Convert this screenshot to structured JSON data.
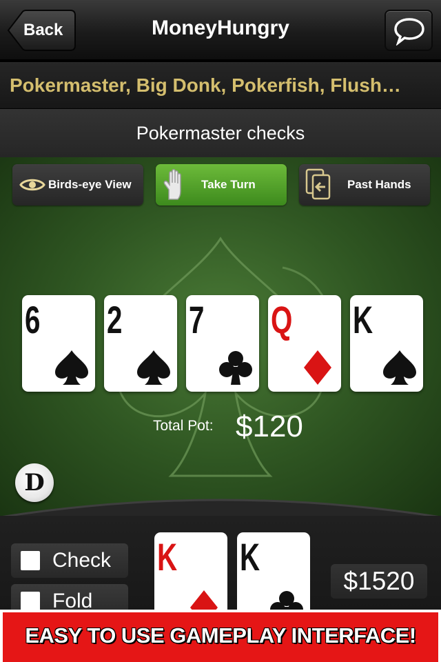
{
  "nav": {
    "back_label": "Back",
    "title": "MoneyHungry",
    "chat_icon": "chat-bubble-icon"
  },
  "players": {
    "names": "Pokermaster, Big Donk, Pokerfish, Flush…"
  },
  "status": {
    "text": "Pokermaster checks"
  },
  "actions": {
    "birds_eye": {
      "label": "Birds-eye View",
      "icon": "eye-icon"
    },
    "take_turn": {
      "label": "Take Turn",
      "icon": "hand-icon"
    },
    "past_hands": {
      "label": "Past Hands",
      "icon": "past-hands-icon"
    }
  },
  "community_cards": [
    {
      "rank": "6",
      "suit": "spades",
      "color": "black"
    },
    {
      "rank": "2",
      "suit": "spades",
      "color": "black"
    },
    {
      "rank": "7",
      "suit": "clubs",
      "color": "black"
    },
    {
      "rank": "Q",
      "suit": "diamonds",
      "color": "red"
    },
    {
      "rank": "K",
      "suit": "spades",
      "color": "black"
    }
  ],
  "pot": {
    "label": "Total Pot:",
    "value": "$120"
  },
  "dealer": {
    "label": "D"
  },
  "player": {
    "options": [
      {
        "label": "Check"
      },
      {
        "label": "Fold"
      }
    ],
    "hand": [
      {
        "rank": "K",
        "suit": "diamonds",
        "color": "red"
      },
      {
        "rank": "K",
        "suit": "clubs",
        "color": "black"
      }
    ],
    "stack": "$1520"
  },
  "promo": {
    "text": "EASY TO USE GAMEPLAY INTERFACE!"
  },
  "colors": {
    "felt": "#2f5622",
    "accent_gold": "#d4be6e",
    "take_turn_green": "#4e9c27",
    "promo_red": "#e51616"
  }
}
